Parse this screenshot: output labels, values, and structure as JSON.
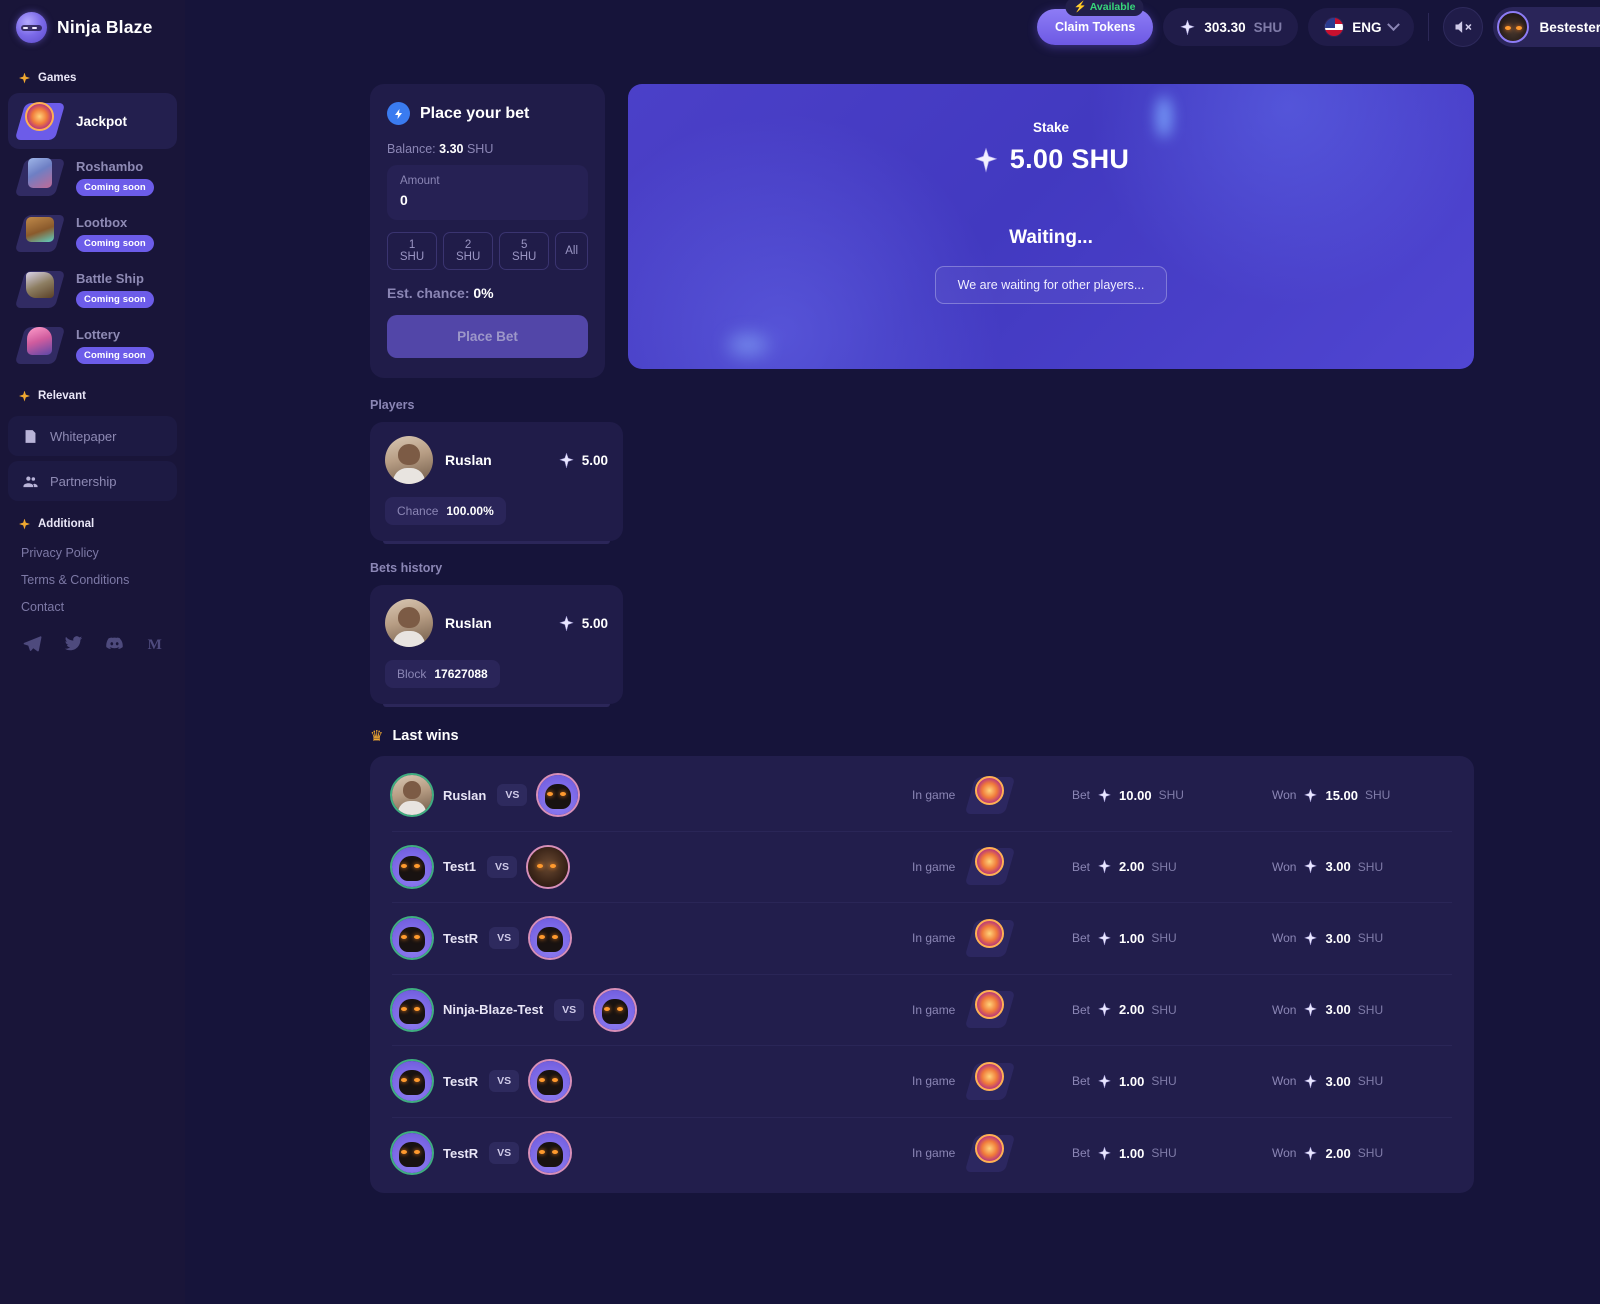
{
  "brand": {
    "name": "Ninja Blaze"
  },
  "sidebar": {
    "games_label": "Games",
    "games": [
      {
        "label": "Jackpot",
        "badge": null,
        "icon": "jackpot-icon",
        "active": true
      },
      {
        "label": "Roshambo",
        "badge": "Coming soon",
        "icon": "roshambo-icon",
        "active": false
      },
      {
        "label": "Lootbox",
        "badge": "Coming soon",
        "icon": "lootbox-icon",
        "active": false
      },
      {
        "label": "Battle Ship",
        "badge": "Coming soon",
        "icon": "battleship-icon",
        "active": false
      },
      {
        "label": "Lottery",
        "badge": "Coming soon",
        "icon": "lottery-icon",
        "active": false
      }
    ],
    "relevant_label": "Relevant",
    "relevant": [
      {
        "label": "Whitepaper",
        "icon": "document-icon"
      },
      {
        "label": "Partnership",
        "icon": "people-icon"
      }
    ],
    "additional_label": "Additional",
    "additional": [
      {
        "label": "Privacy Policy"
      },
      {
        "label": "Terms & Conditions"
      },
      {
        "label": "Contact"
      }
    ],
    "socials": [
      {
        "name": "telegram-icon"
      },
      {
        "name": "twitter-icon"
      },
      {
        "name": "discord-icon"
      },
      {
        "name": "medium-icon"
      }
    ]
  },
  "header": {
    "available_badge": "Available",
    "claim_label": "Claim Tokens",
    "balance_value": "303.30",
    "balance_unit": "SHU",
    "language": "ENG",
    "sound_icon": "speaker-muted-icon",
    "user_name": "Bestesterons"
  },
  "bet_card": {
    "title": "Place your bet",
    "balance_label": "Balance:",
    "balance_value": "3.30",
    "balance_unit": "SHU",
    "amount_label": "Amount",
    "amount_value": "0",
    "quick_amounts": [
      "1 SHU",
      "2 SHU",
      "5 SHU",
      "All"
    ],
    "chance_label": "Est. chance:",
    "chance_value": "0%",
    "place_bet_label": "Place Bet"
  },
  "stake_panel": {
    "stake_label": "Stake",
    "stake_value": "5.00 SHU",
    "status_title": "Waiting...",
    "status_note": "We are waiting for other players..."
  },
  "players": {
    "label": "Players",
    "items": [
      {
        "name": "Ruslan",
        "amount": "5.00",
        "tag_key": "Chance",
        "tag_value": "100.00%"
      }
    ]
  },
  "bets_history": {
    "label": "Bets history",
    "items": [
      {
        "name": "Ruslan",
        "amount": "5.00",
        "tag_key": "Block",
        "tag_value": "17627088"
      }
    ]
  },
  "last_wins": {
    "label": "Last wins",
    "vs_label": "VS",
    "in_game_label": "In game",
    "bet_label": "Bet",
    "won_label": "Won",
    "unit": "SHU",
    "rows": [
      {
        "winner": "Ruslan",
        "winner_avatar": "photo",
        "opponent_avatar": "ninja-purple",
        "bet": "10.00",
        "won": "15.00"
      },
      {
        "winner": "Test1",
        "winner_avatar": "ninja-purple",
        "opponent_avatar": "ninja-fire",
        "bet": "2.00",
        "won": "3.00"
      },
      {
        "winner": "TestR",
        "winner_avatar": "ninja-purple",
        "opponent_avatar": "ninja-purple",
        "bet": "1.00",
        "won": "3.00"
      },
      {
        "winner": "Ninja-Blaze-Test",
        "winner_avatar": "ninja-purple",
        "opponent_avatar": "ninja-purple",
        "bet": "2.00",
        "won": "3.00"
      },
      {
        "winner": "TestR",
        "winner_avatar": "ninja-purple",
        "opponent_avatar": "ninja-purple",
        "bet": "1.00",
        "won": "3.00"
      },
      {
        "winner": "TestR",
        "winner_avatar": "ninja-purple",
        "opponent_avatar": "ninja-purple",
        "bet": "1.00",
        "won": "2.00"
      }
    ]
  },
  "colors": {
    "background": "#16143a",
    "sidebar": "#191539",
    "panel": "#201c49",
    "accent_purple": "#6c5ce9",
    "accent_blue": "#3a7bf0",
    "stake_gradient_from": "#4b40c8",
    "stake_gradient_to": "#5046d2",
    "green": "#37d67a",
    "gold": "#f0a830"
  }
}
